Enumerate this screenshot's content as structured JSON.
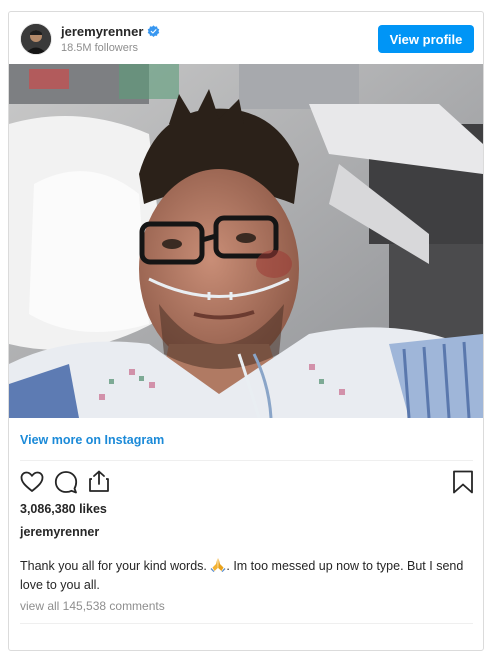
{
  "post": {
    "username": "jeremyrenner",
    "followers": "18.5M followers",
    "view_profile_label": "View profile",
    "view_more_label": "View more on Instagram",
    "likes": "3,086,380 likes",
    "caption_username": "jeremyrenner",
    "caption_text_part1": "Thank you all for your kind words. ",
    "caption_text_part2": ". Im too messed up now to type. But I send love to you all.",
    "comments_link": "view all 145,538 comments"
  },
  "colors": {
    "accent": "#0095f6",
    "link": "#1b8ad8",
    "verified": "#3897f0",
    "muted": "#8e8e8e",
    "text": "#262626"
  },
  "icons": {
    "avatar": "profile-photo",
    "verified": "verified-badge-icon",
    "like": "heart-icon",
    "comment": "comment-bubble-icon",
    "share": "share-icon",
    "save": "bookmark-icon",
    "emoji": "folded-hands-emoji"
  }
}
